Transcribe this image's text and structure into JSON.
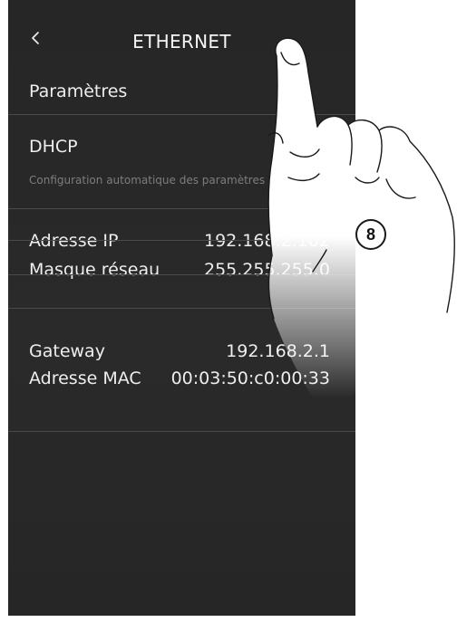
{
  "header": {
    "title": "ETHERNET"
  },
  "section": {
    "label": "Paramètres"
  },
  "dhcp": {
    "label": "DHCP",
    "description": "Configuration automatique des paramètres"
  },
  "rows": [
    {
      "label": "Adresse IP",
      "value": "192.168.2.102"
    },
    {
      "label": "Masque réseau",
      "value": "255.255.255.0"
    },
    {
      "label": "Gateway",
      "value": "192.168.2.1"
    },
    {
      "label": "Adresse MAC",
      "value": "00:03:50:c0:00:33"
    }
  ],
  "callout": {
    "number": "8"
  },
  "icons": {
    "back": "chevron-left-icon",
    "hand": "pointing-hand-icon"
  },
  "colors": {
    "screen_background": "#282828",
    "text": "#eeeeee",
    "description_text": "#7d7d7d",
    "divider": "#4a4a4a"
  }
}
